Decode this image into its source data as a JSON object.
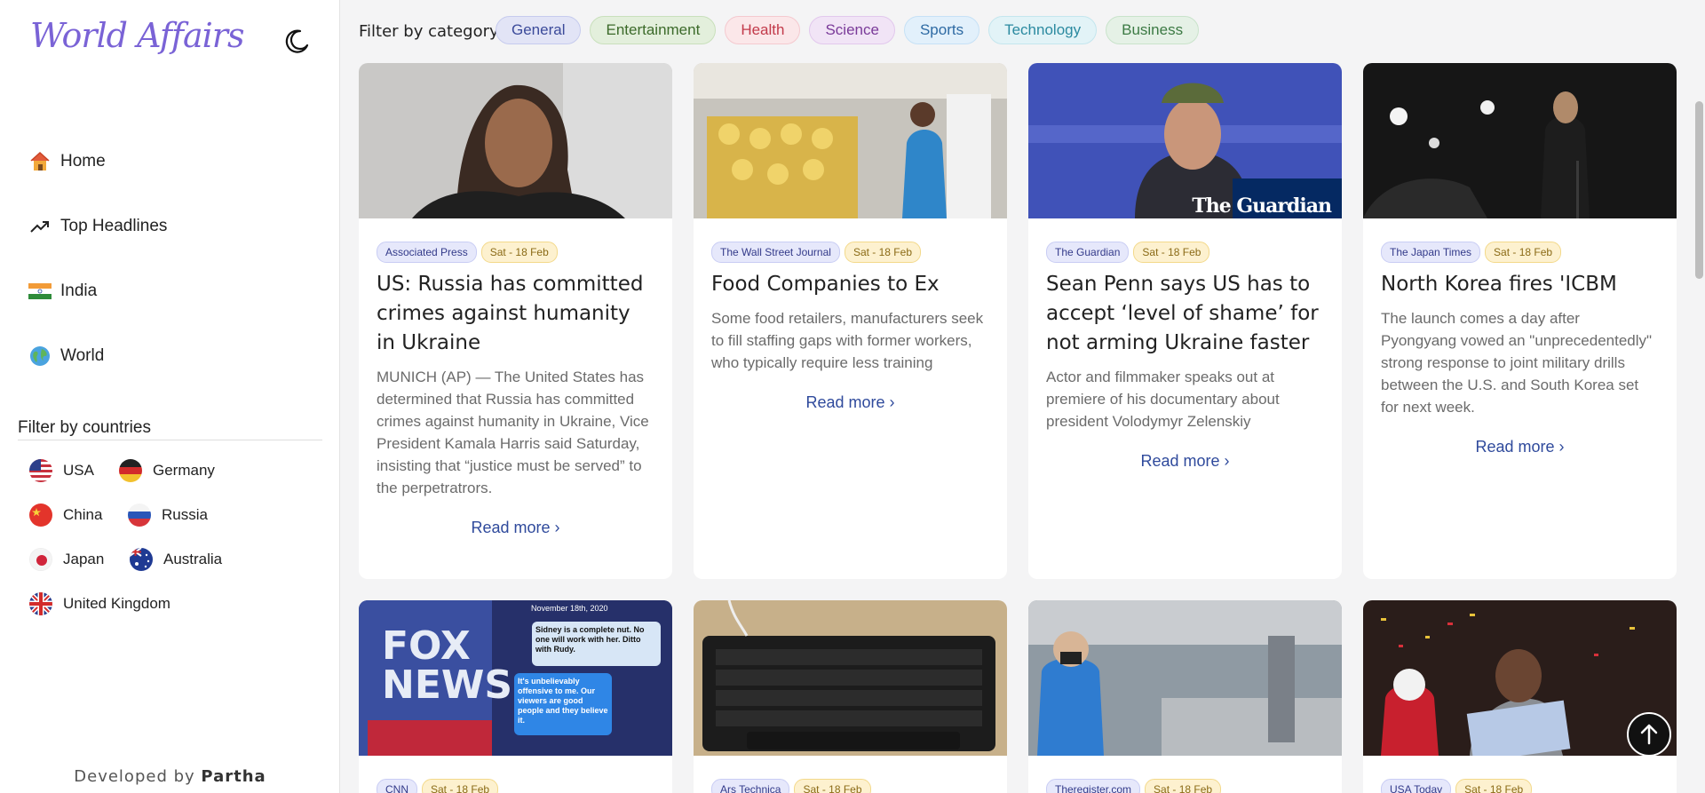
{
  "brand": "World Affairs",
  "nav": [
    {
      "label": "Home",
      "icon": "home-icon"
    },
    {
      "label": "Top Headlines",
      "icon": "trending-up-icon"
    },
    {
      "label": "India",
      "icon": "india-flag-icon"
    },
    {
      "label": "World",
      "icon": "globe-icon"
    }
  ],
  "countries": {
    "title": "Filter by countries",
    "items": [
      {
        "label": "USA"
      },
      {
        "label": "Germany"
      },
      {
        "label": "China"
      },
      {
        "label": "Russia"
      },
      {
        "label": "Japan"
      },
      {
        "label": "Australia"
      },
      {
        "label": "United Kingdom"
      }
    ]
  },
  "footer": {
    "prefix": "Developed by",
    "name": "Partha"
  },
  "filter": {
    "label": "Filter by category",
    "categories": [
      {
        "label": "General",
        "bg": "#e2e4f6",
        "border": "#c6cbee",
        "color": "#3b4a9a"
      },
      {
        "label": "Entertainment",
        "bg": "#e3efdc",
        "border": "#c9e0bc",
        "color": "#3c6a2a"
      },
      {
        "label": "Health",
        "bg": "#fbe7e9",
        "border": "#f4c9cf",
        "color": "#c23a4a"
      },
      {
        "label": "Science",
        "bg": "#f1e4f6",
        "border": "#e2c8ed",
        "color": "#7a3a99"
      },
      {
        "label": "Sports",
        "bg": "#e2f0fb",
        "border": "#c6e1f6",
        "color": "#2e6aa3"
      },
      {
        "label": "Technology",
        "bg": "#e2f3f7",
        "border": "#c4e6ee",
        "color": "#2b8aa0"
      },
      {
        "label": "Business",
        "bg": "#e5f1e6",
        "border": "#c9e3cb",
        "color": "#3c7a44"
      }
    ]
  },
  "articles": [
    {
      "source": "Associated Press",
      "date": "Sat - 18 Feb",
      "title": "US: Russia has committed crimes against humanity in Ukraine",
      "desc": "MUNICH (AP) — The United States has determined that Russia has committed crimes against humanity in Ukraine, Vice President Kamala Harris said Saturday, insisting that “justice must be served” to the perpetratrors.",
      "read_more": "Read more"
    },
    {
      "source": "The Wall Street Journal",
      "date": "Sat - 18 Feb",
      "title": "Food Companies to Ex",
      "desc": "Some food retailers, manufacturers seek to fill staffing gaps with former workers, who typically require less training",
      "read_more": "Read more"
    },
    {
      "source": "The Guardian",
      "date": "Sat - 18 Feb",
      "title": "Sean Penn says US has to accept ‘level of shame’ for not arming Ukraine faster",
      "desc": "Actor and filmmaker speaks out at premiere of his documentary about president Volodymyr Zelenskiy",
      "read_more": "Read more",
      "image_overlay": "The Guardian"
    },
    {
      "source": "The Japan Times",
      "date": "Sat - 18 Feb",
      "title": "North Korea fires 'ICBM",
      "desc": "The launch comes a day after Pyongyang vowed an \"unprecedentedly\" strong response to joint military drills between the U.S. and South Korea set for next week.",
      "read_more": "Read more"
    },
    {
      "source": "CNN",
      "date": "Sat - 18 Feb",
      "image_text": [
        "November 18th, 2020",
        "Sidney is a complete nut. No one will work with her. Ditto with Rudy.",
        "It's unbelievably offensive to me. Our viewers are good people and they believe it."
      ]
    },
    {
      "source": "Ars Technica",
      "date": "Sat - 18 Feb"
    },
    {
      "source": "Theregister.com",
      "date": "Sat - 18 Feb"
    },
    {
      "source": "USA Today",
      "date": "Sat - 18 Feb"
    }
  ]
}
